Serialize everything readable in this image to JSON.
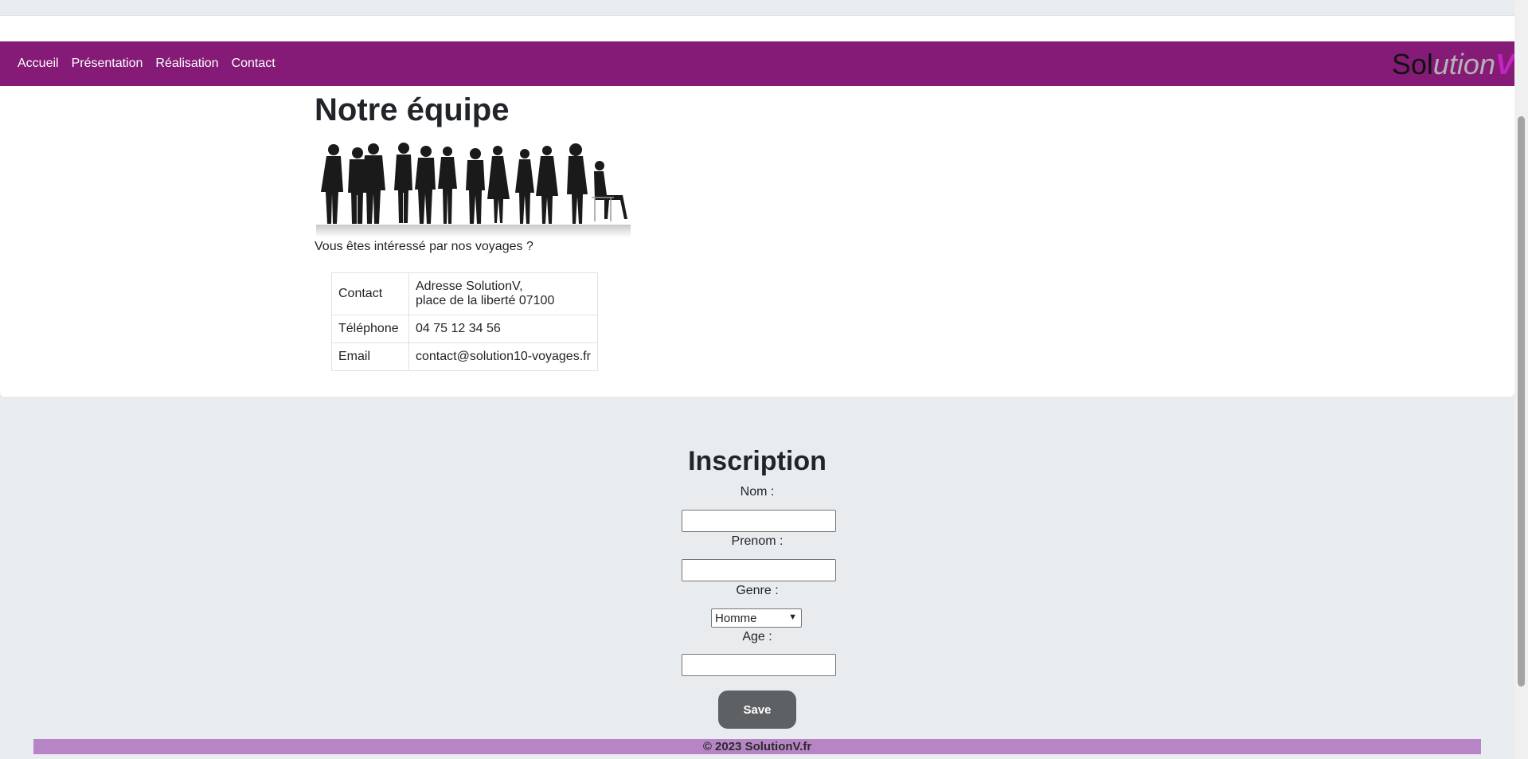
{
  "nav": {
    "links": [
      "Accueil",
      "Présentation",
      "Réalisation",
      "Contact"
    ],
    "logo": {
      "part1": "Sol",
      "part2": "ution",
      "part3": "V"
    }
  },
  "team": {
    "title": "Notre équipe",
    "interest": "Vous êtes intéressé par nos voyages ?"
  },
  "contact_table": {
    "rows": [
      {
        "label": "Contact",
        "value_line1": "Adresse SolutionV,",
        "value_line2": "place de la liberté 07100"
      },
      {
        "label": "Téléphone",
        "value": "04 75 12 34 56"
      },
      {
        "label": "Email",
        "value": "contact@solution10-voyages.fr"
      }
    ]
  },
  "form": {
    "title": "Inscription",
    "nom_label": "Nom :",
    "prenom_label": "Prenom :",
    "genre_label": "Genre :",
    "genre_selected": "Homme",
    "age_label": "Age :",
    "save_label": "Save"
  },
  "footer": {
    "text": "© 2023 SolutionV.fr"
  },
  "colors": {
    "navbar": "#851b77",
    "footer": "#b785c6",
    "logo_accent": "#c324c3",
    "button": "#5e6163"
  }
}
